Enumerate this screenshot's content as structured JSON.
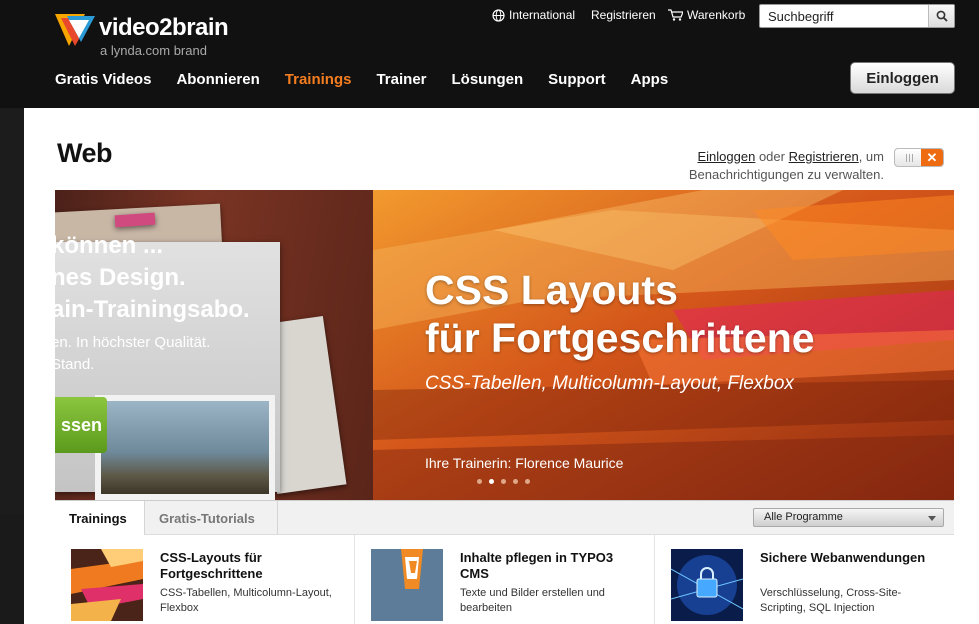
{
  "header": {
    "logo": {
      "brand": "video2brain",
      "sub": "a lynda.com brand"
    },
    "util": {
      "international": "International",
      "register": "Registrieren",
      "cart": "Warenkorb"
    },
    "search": {
      "placeholder": "Suchbegriff"
    },
    "nav": [
      "Gratis Videos",
      "Abonnieren",
      "Trainings",
      "Trainer",
      "Lösungen",
      "Support",
      "Apps"
    ],
    "active_nav": "Trainings",
    "login_label": "Einloggen"
  },
  "page": {
    "title": "Web",
    "notify": {
      "login": "Einloggen",
      "or": "oder",
      "register": "Registrieren",
      "rest": ", um Benachrichtigungen zu verwalten."
    }
  },
  "hero": {
    "left_lines": [
      "können ...",
      "nes Design.",
      "ain-Trainingsabo."
    ],
    "left_body": [
      "en. In höchster Qualität.",
      "Stand."
    ],
    "left_button": "ssen",
    "title_line1": "CSS Layouts",
    "title_line2": "für Fortgeschrittene",
    "subtitle": "CSS-Tabellen, Multicolumn-Layout, Flexbox",
    "trainer": "Ihre Trainerin: Florence Maurice",
    "slides_total": 5,
    "slide_active": 2
  },
  "tabs": {
    "trainings": "Trainings",
    "tutorials": "Gratis-Tutorials",
    "programs": "Alle Programme"
  },
  "cards": [
    {
      "title": "CSS-Layouts für Fortgeschrittene",
      "desc": "CSS-Tabellen, Multicolumn-Layout, Flexbox"
    },
    {
      "title": "Inhalte pflegen in TYPO3 CMS",
      "desc": "Texte und Bilder erstellen und bearbeiten"
    },
    {
      "title": "Sichere Webanwendungen",
      "desc": "Verschlüsselung, Cross-Site-Scripting, SQL Injection"
    }
  ],
  "colors": {
    "accent": "#f47d20",
    "topbar": "#111111",
    "green_button": "#6fae2a",
    "toggle_x": "#ef6b12"
  }
}
